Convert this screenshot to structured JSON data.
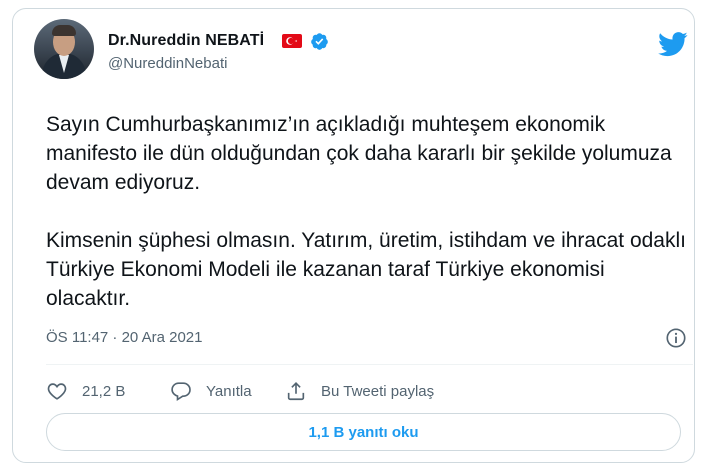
{
  "author": {
    "display_name": "Dr.Nureddin NEBATİ",
    "handle": "@NureddinNebati"
  },
  "tweet": {
    "paragraphs": [
      "Sayın Cumhurbaşkanımız’ın açıkladığı muhteşem ekonomik manifesto ile dün olduğundan çok daha kararlı bir şekilde yolumuza devam ediyoruz.",
      "Kimsenin şüphesi olmasın. Yatırım, üretim, istihdam ve ihracat odaklı Türkiye Ekonomi Modeli ile kazanan taraf Türkiye ekonomisi olacaktır."
    ],
    "timestamp": "ÖS 11:47 · 20 Ara 2021"
  },
  "actions": {
    "like_count": "21,2 B",
    "reply_label": "Yanıtla",
    "share_label": "Bu Tweeti paylaş"
  },
  "read_replies_label": "1,1 B yanıtı oku",
  "icons": {
    "flag": "turkey-flag-icon",
    "verified": "verified-badge-icon",
    "brand": "twitter-bird-icon",
    "info": "info-icon",
    "like": "heart-icon",
    "reply": "speech-bubble-icon",
    "share": "share-upload-icon"
  },
  "colors": {
    "accent": "#1d9bf0",
    "secondary_text": "#536471",
    "border": "#cfd9de",
    "flag_red": "#e30a17"
  }
}
